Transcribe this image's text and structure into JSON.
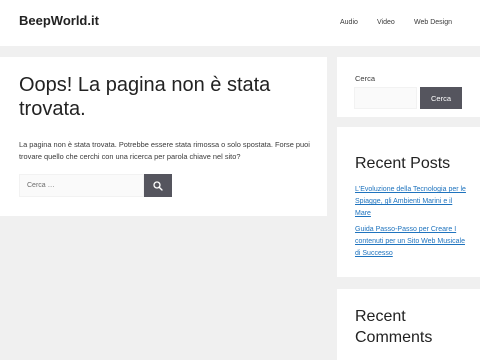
{
  "site": {
    "title": "BeepWorld.it"
  },
  "nav": {
    "items": [
      "Audio",
      "Video",
      "Web Design"
    ]
  },
  "main": {
    "title": "Oops! La pagina non è stata trovata.",
    "text": "La pagina non è stata trovata. Potrebbe essere stata rimossa o solo spostata. Forse puoi trovare quello che cerchi con una ricerca per parola chiave nel sito?",
    "search": {
      "placeholder": "Cerca …",
      "button_icon": "search-icon"
    }
  },
  "sidebar": {
    "search": {
      "label": "Cerca",
      "button_label": "Cerca"
    },
    "recent_posts": {
      "title": "Recent Posts",
      "items": [
        "L'Evoluzione della Tecnologia per le Spiagge, gli Ambienti Marini e il Mare",
        "Guida Passo-Passo per Creare I contenuti per un Sito Web Musicale di Successo"
      ]
    },
    "recent_comments": {
      "title": "Recent Comments"
    }
  },
  "colors": {
    "accent": "#55555e",
    "link": "#1e73be",
    "background": "#f0f0f0"
  }
}
